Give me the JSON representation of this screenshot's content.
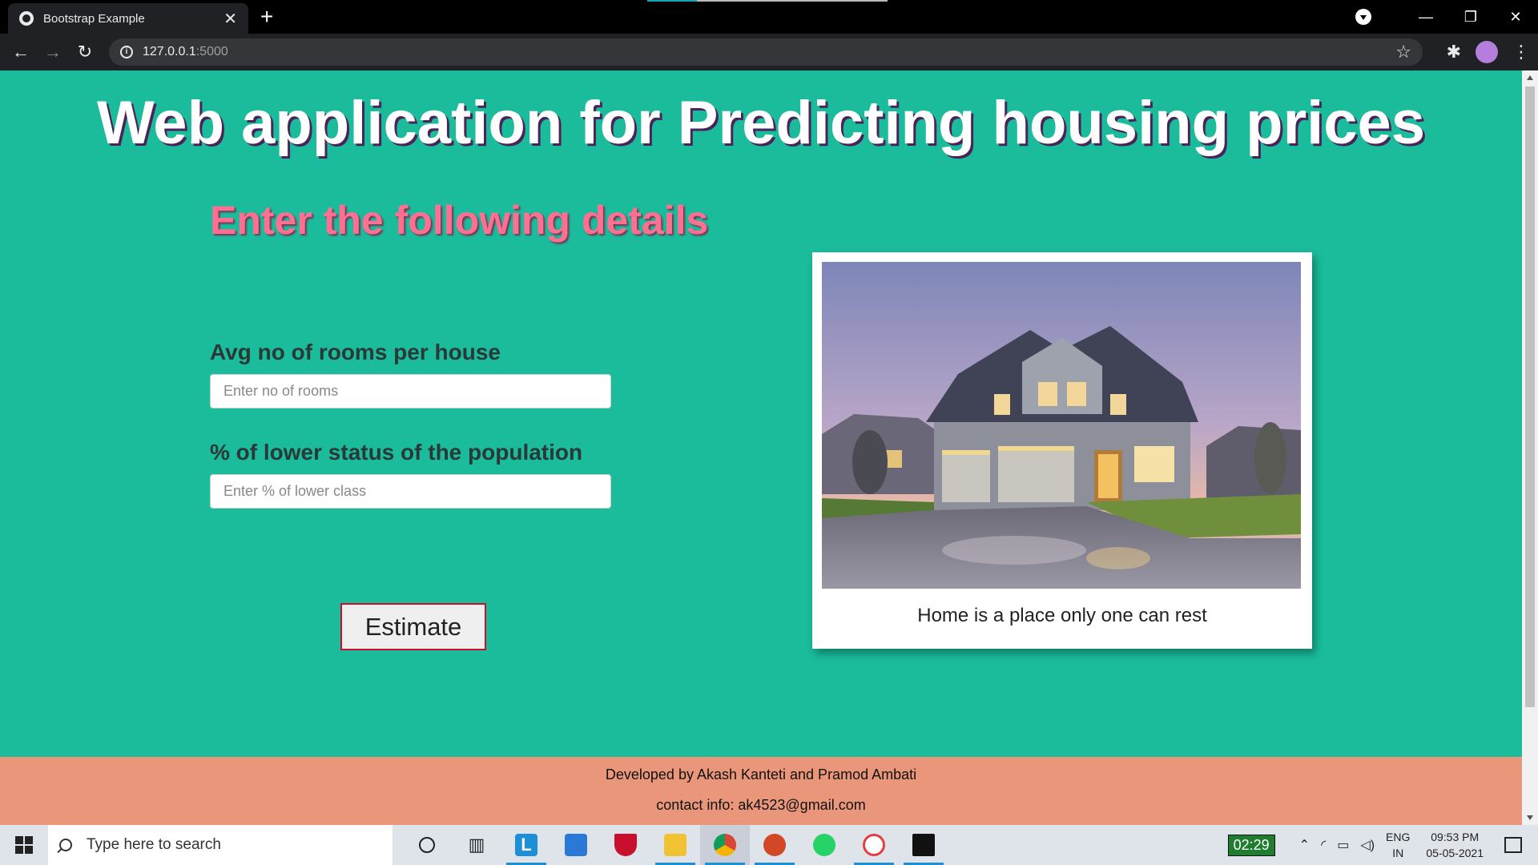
{
  "browser": {
    "tab_title": "Bootstrap Example",
    "url_host": "127.0.0.1",
    "url_port": ":5000"
  },
  "page": {
    "title": "Web application for Predicting housing prices",
    "subtitle": "Enter the following details",
    "form": {
      "rooms_label": "Avg no of rooms per house",
      "rooms_placeholder": "Enter no of rooms",
      "rooms_value": "",
      "lstat_label": "% of lower status of the population",
      "lstat_placeholder": "Enter % of lower class",
      "lstat_value": "",
      "estimate_label": "Estimate"
    },
    "image_card": {
      "caption": "Home is a place only one can rest"
    },
    "footer": {
      "developers": "Developed by Akash Kanteti and Pramod Ambati",
      "contact": "contact info: ak4523@gmail.com"
    }
  },
  "colors": {
    "page_bg": "#1abc9c",
    "footer_bg": "#e9967a",
    "subtitle": "#ff6f91",
    "estimate_border": "#c8102e"
  },
  "taskbar": {
    "search_placeholder": "Type here to search",
    "timer": "02:29",
    "lang_top": "ENG",
    "lang_bottom": "IN",
    "time": "09:53 PM",
    "date": "05-05-2021",
    "apps": [
      "cortana-icon",
      "task-view-icon",
      "l-app-icon",
      "calendar-icon",
      "mcafee-icon",
      "file-explorer-icon",
      "chrome-icon",
      "powerpoint-icon",
      "whatsapp-icon",
      "paint-icon",
      "terminal-icon"
    ]
  }
}
